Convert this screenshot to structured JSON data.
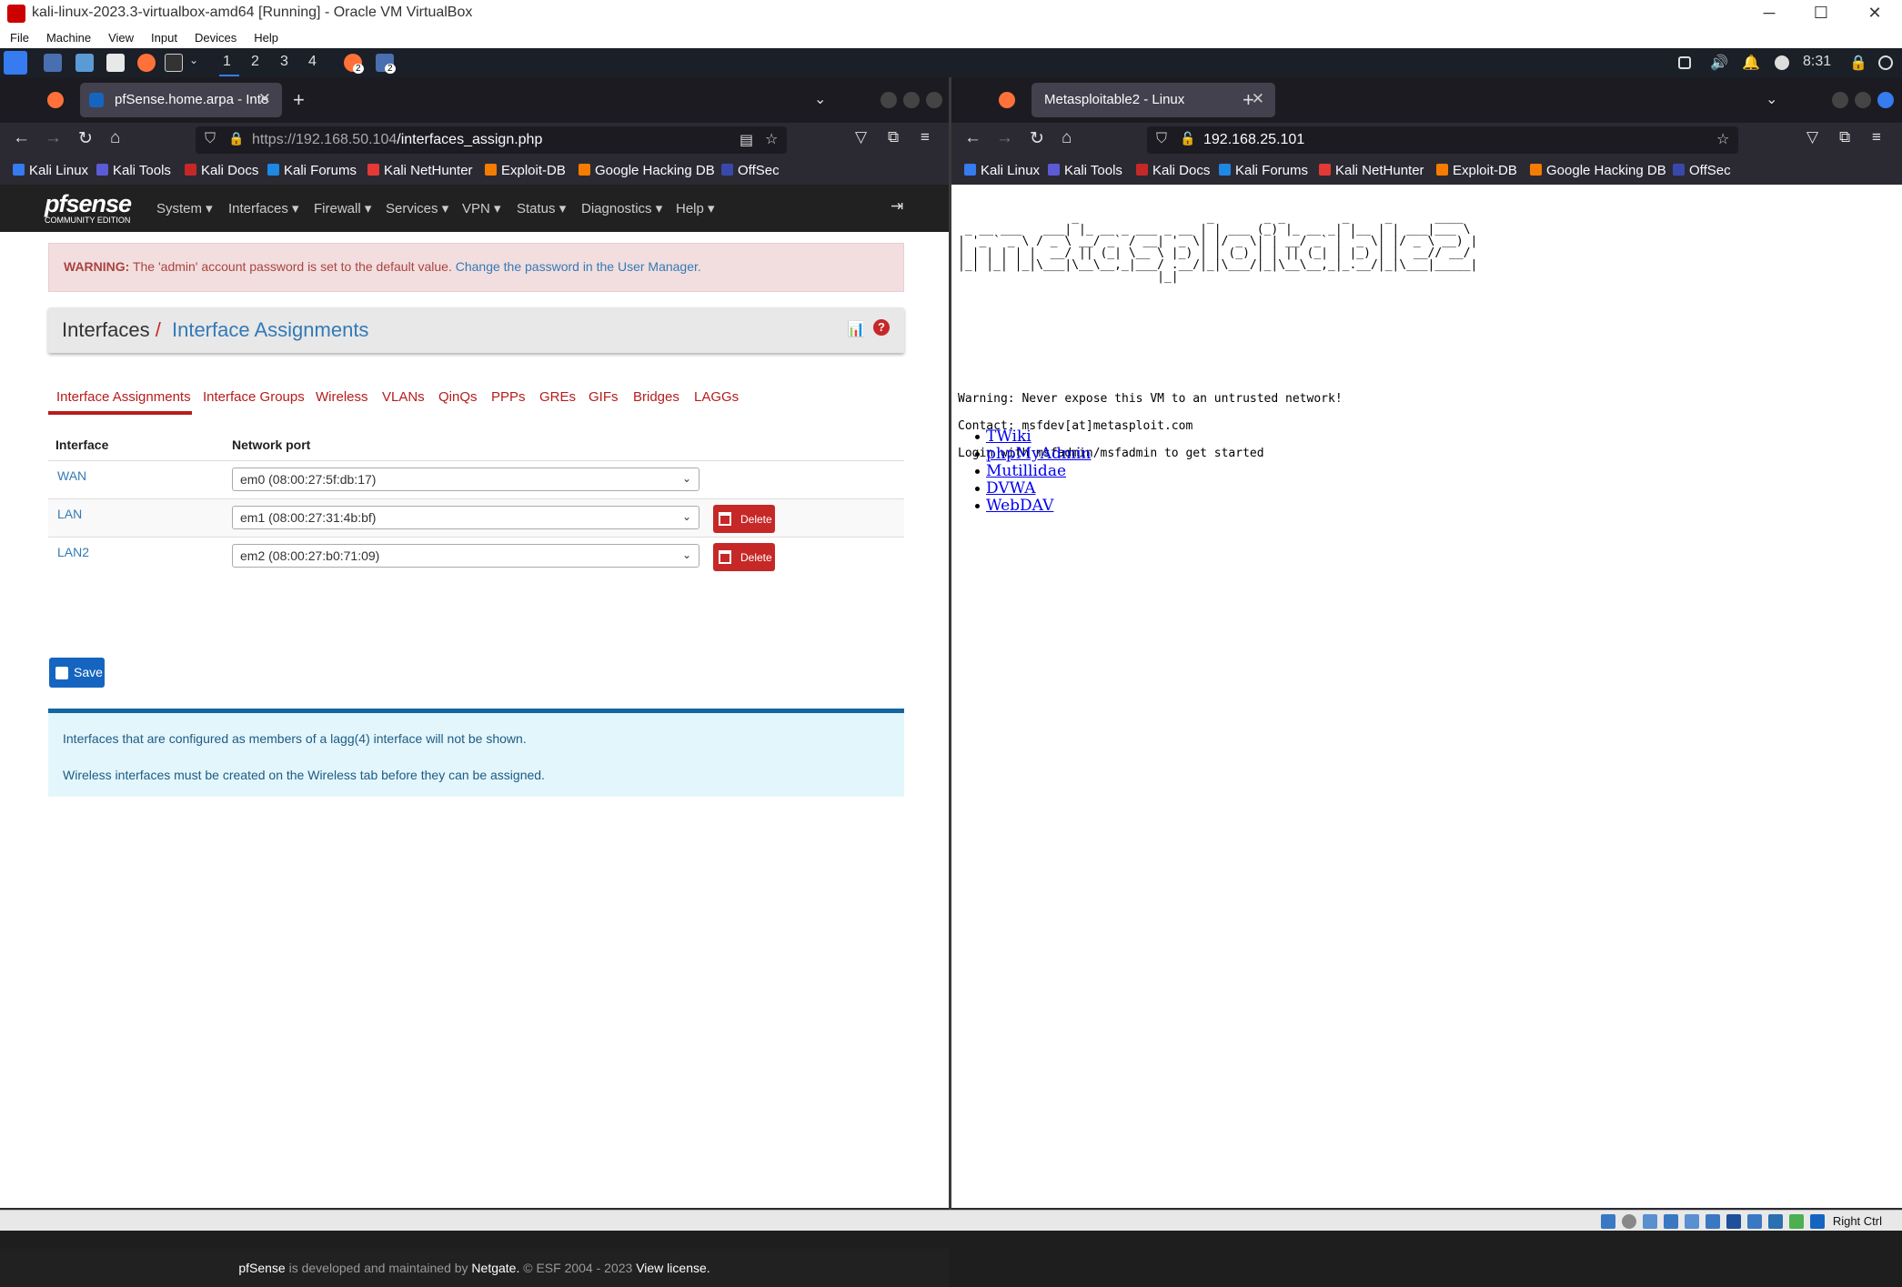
{
  "vbox": {
    "title": "kali-linux-2023.3-virtualbox-amd64 [Running] - Oracle VM VirtualBox",
    "menu": [
      "File",
      "Machine",
      "View",
      "Input",
      "Devices",
      "Help"
    ],
    "status_right": "Right Ctrl"
  },
  "panel": {
    "workspaces": [
      "1",
      "2",
      "3",
      "4"
    ],
    "badge1": "2",
    "badge2": "2",
    "clock": "8:31"
  },
  "left_browser": {
    "tab_title": "pfSense.home.arpa - Inte",
    "url_host": "https://192.168.50.104",
    "url_path": "/interfaces_assign.php",
    "bookmarks": [
      "Kali Linux",
      "Kali Tools",
      "Kali Docs",
      "Kali Forums",
      "Kali NetHunter",
      "Exploit-DB",
      "Google Hacking DB",
      "OffSec"
    ]
  },
  "right_browser": {
    "tab_title": "Metasploitable2 - Linux",
    "url": "192.168.25.101",
    "bookmarks": [
      "Kali Linux",
      "Kali Tools",
      "Kali Docs",
      "Kali Forums",
      "Kali NetHunter",
      "Exploit-DB",
      "Google Hacking DB",
      "OffSec"
    ]
  },
  "pfsense": {
    "logo": "pfsense",
    "logo_sub": "COMMUNITY EDITION",
    "nav": [
      "System",
      "Interfaces",
      "Firewall",
      "Services",
      "VPN",
      "Status",
      "Diagnostics",
      "Help"
    ],
    "warning_label": "WARNING:",
    "warning_text": " The 'admin' account password is set to the default value. ",
    "warning_link": "Change the password in the User Manager.",
    "breadcrumb_root": "Interfaces",
    "breadcrumb_sep": "/",
    "breadcrumb_current": "Interface Assignments",
    "tabs": [
      "Interface Assignments",
      "Interface Groups",
      "Wireless",
      "VLANs",
      "QinQs",
      "PPPs",
      "GREs",
      "GIFs",
      "Bridges",
      "LAGGs"
    ],
    "col_interface": "Interface",
    "col_port": "Network port",
    "rows": [
      {
        "name": "WAN",
        "port": "em0 (08:00:27:5f:db:17)"
      },
      {
        "name": "LAN",
        "port": "em1 (08:00:27:31:4b:bf)",
        "action": "Delete"
      },
      {
        "name": "LAN2",
        "port": "em2 (08:00:27:b0:71:09)",
        "action": "Delete"
      }
    ],
    "save_label": "Save",
    "info1": "Interfaces that are configured as members of a lagg(4) interface will not be shown.",
    "info2": "Wireless interfaces must be created on the Wireless tab before they can be assigned.",
    "footer_brand": "pfSense",
    "footer_mid": " is developed and maintained by ",
    "footer_netgate": "Netgate.",
    "footer_copy": " © ESF 2004 - 2023 ",
    "footer_license": "View license."
  },
  "metasploitable": {
    "ascii_art": "                _                  _       _ _        _     _      ____  \n _ __ ___   ___| |_ __ _ ___ _ __ | | ___ (_) |_ __ _| |__ | | ___|___ \\ \n| '_ ` _ \\ / _ \\ __/ _` / __| '_ \\| |/ _ \\| | __/ _` | '_ \\| |/ _ \\ __) |\n| | | | | |  __/ || (_| \\__ \\ |_) | | (_) | | || (_| | |_) | |  __// __/ \n|_| |_| |_|\\___|\\__\\__,_|___/ .__/|_|\\___/|_|\\__\\__,_|_.__/|_|\\___|_____|\n                            |_|                                          ",
    "warning": "Warning: Never expose this VM to an untrusted network!",
    "contact": "Contact: msfdev[at]metasploit.com",
    "login": "Login with msfadmin/msfadmin to get started",
    "links": [
      "TWiki",
      "phpMyAdmin",
      "Mutillidae",
      "DVWA",
      "WebDAV"
    ]
  }
}
